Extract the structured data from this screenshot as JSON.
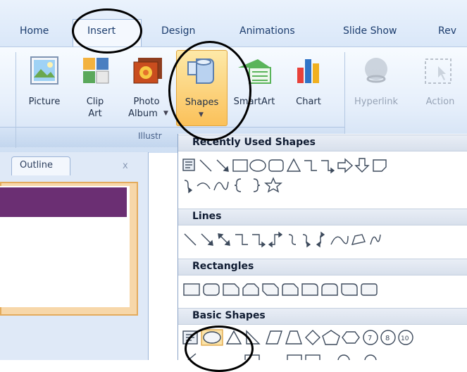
{
  "ribbon_tabs": [
    "Home",
    "Insert",
    "Design",
    "Animations",
    "Slide Show",
    "Rev"
  ],
  "ribbon_buttons": {
    "picture": [
      "Picture"
    ],
    "clipart": [
      "Clip",
      "Art"
    ],
    "photo": [
      "Photo",
      "Album"
    ],
    "shapes": [
      "Shapes"
    ],
    "smartart": [
      "SmartArt"
    ],
    "chart": [
      "Chart"
    ],
    "hyperlink": [
      "Hyperlink"
    ],
    "action": [
      "Action"
    ]
  },
  "group_label": "Illustr",
  "outline_pane": {
    "tab_label": "Outline",
    "close": "x"
  },
  "gallery": {
    "sections": [
      "Recently Used Shapes",
      "Lines",
      "Rectangles",
      "Basic Shapes"
    ]
  }
}
